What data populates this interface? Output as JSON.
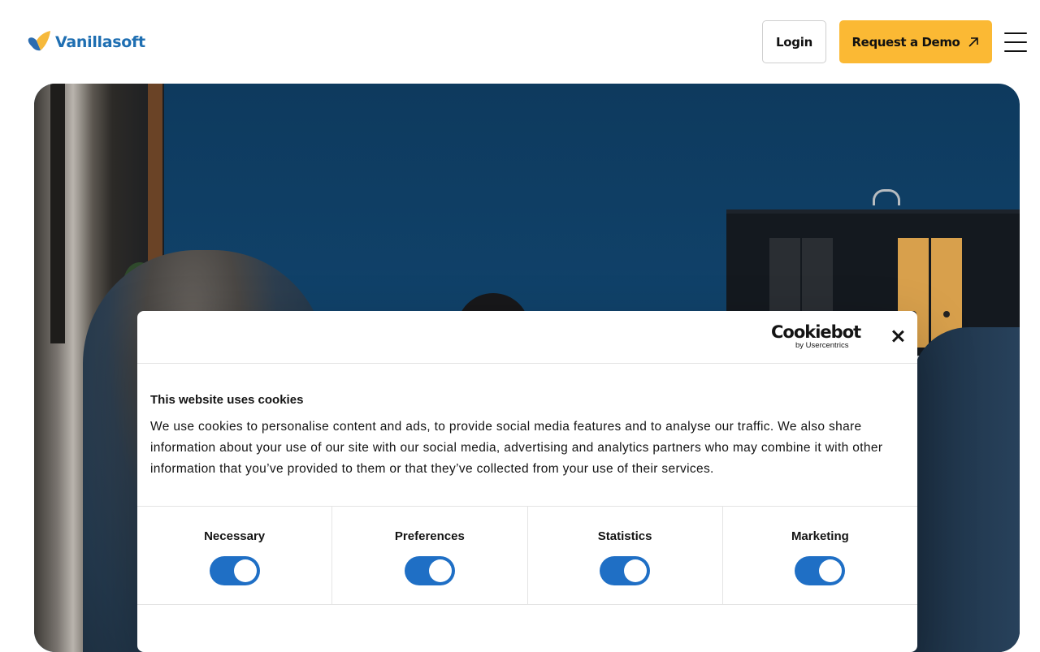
{
  "header": {
    "logo_text": "Vanillasoft",
    "login_label": "Login",
    "demo_label": "Request a Demo",
    "demo_icon": "arrow-up-right-icon",
    "menu_icon": "hamburger-menu-icon"
  },
  "colors": {
    "brand_blue": "#1f6fb2",
    "demo_yellow": "#fbb934",
    "toggle_blue": "#1f6fc5"
  },
  "cookie_dialog": {
    "brand_name": "Cookiebot",
    "brand_sub": "by Usercentrics",
    "close_icon": "close-icon",
    "title": "This website uses cookies",
    "body": "We use cookies to personalise content and ads, to provide social media features and to analyse our traffic. We also share information about your use of our site with our social media, advertising and analytics partners who may combine it with other information that you’ve provided to them or that they’ve collected from your use of their services.",
    "categories": [
      {
        "label": "Necessary",
        "enabled": true
      },
      {
        "label": "Preferences",
        "enabled": true
      },
      {
        "label": "Statistics",
        "enabled": true
      },
      {
        "label": "Marketing",
        "enabled": true
      }
    ]
  }
}
